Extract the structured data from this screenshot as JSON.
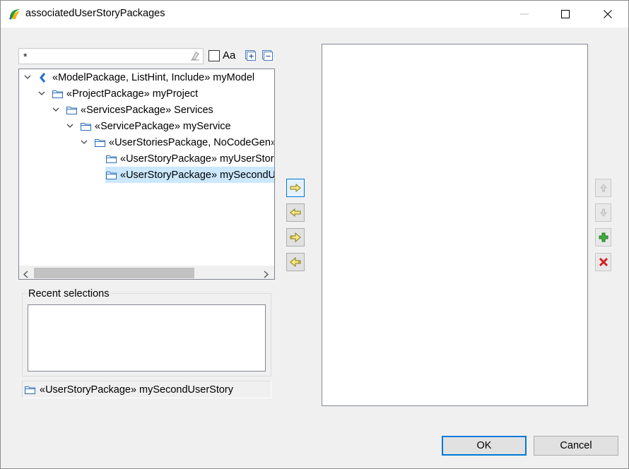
{
  "window": {
    "title": "associatedUserStoryPackages",
    "icon": "app-logo-icon"
  },
  "filter": {
    "value": "*",
    "case_label": "Aa"
  },
  "tree": {
    "nodes": [
      {
        "label": "«ModelPackage, ListHint, Include» myModel",
        "icon": "model-icon",
        "expanded": true
      },
      {
        "label": "«ProjectPackage» myProject",
        "icon": "package-icon",
        "expanded": true
      },
      {
        "label": "«ServicesPackage» Services",
        "icon": "package-icon",
        "expanded": true
      },
      {
        "label": "«ServicePackage» myService",
        "icon": "package-icon",
        "expanded": true
      },
      {
        "label": "«UserStoriesPackage, NoCodeGen»",
        "icon": "package-icon",
        "expanded": true
      },
      {
        "label": "«UserStoryPackage» myUserStory",
        "icon": "package-icon",
        "expanded": false
      },
      {
        "label": "«UserStoryPackage» mySecondUserStory",
        "icon": "package-icon",
        "expanded": false,
        "selected": true
      }
    ]
  },
  "recent": {
    "label": "Recent selections"
  },
  "status": {
    "text": "«UserStoryPackage» mySecondUserStory"
  },
  "buttons": {
    "ok": "OK",
    "cancel": "Cancel"
  },
  "colors": {
    "selection": "#cce8ff",
    "accent": "#0078d7",
    "arrow_fill": "#f7e97a"
  }
}
